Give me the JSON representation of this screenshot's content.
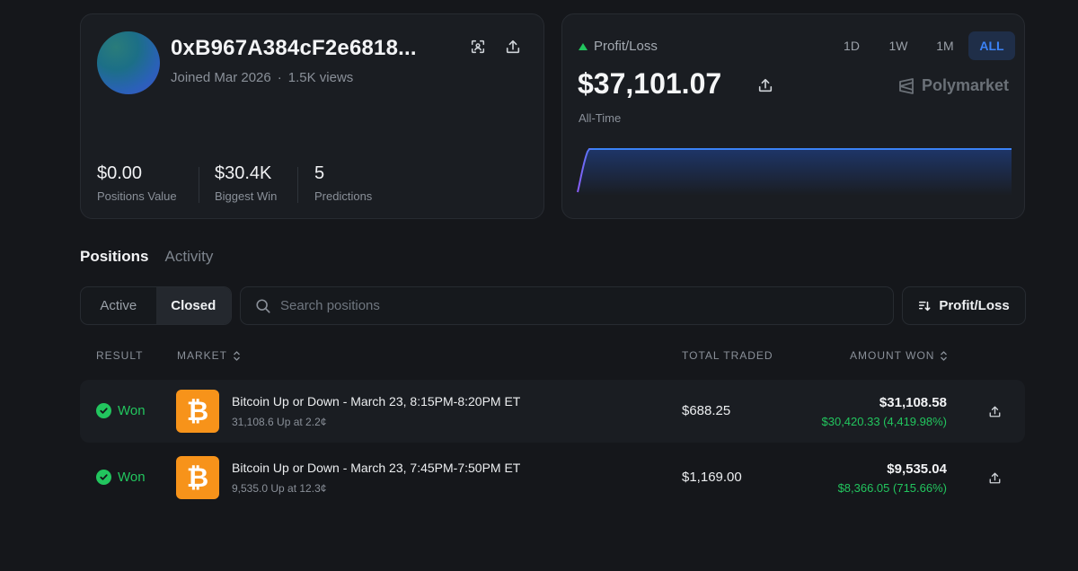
{
  "profile": {
    "wallet": "0xB967A384cF2e6818...",
    "joined": "Joined Mar 2026",
    "views": "1.5K views",
    "stats": [
      {
        "value": "$0.00",
        "label": "Positions Value"
      },
      {
        "value": "$30.4K",
        "label": "Biggest Win"
      },
      {
        "value": "5",
        "label": "Predictions"
      }
    ]
  },
  "pnl": {
    "label": "Profit/Loss",
    "value": "$37,101.07",
    "period": "All-Time",
    "brand": "Polymarket",
    "ranges": [
      "1D",
      "1W",
      "1M",
      "ALL"
    ],
    "active_range": "ALL",
    "chart": {
      "trend": "sharp rise then flat",
      "line_color": "#3b82f6"
    }
  },
  "tabs": {
    "positions": "Positions",
    "activity": "Activity"
  },
  "filter": {
    "active": "Active",
    "closed": "Closed",
    "selected": "Closed"
  },
  "search": {
    "placeholder": "Search positions"
  },
  "sort": {
    "label": "Profit/Loss"
  },
  "table": {
    "headers": {
      "result": "RESULT",
      "market": "MARKET",
      "total": "TOTAL TRADED",
      "amount": "AMOUNT WON"
    },
    "rows": [
      {
        "result": "Won",
        "market": "Bitcoin Up or Down - March 23, 8:15PM-8:20PM ET",
        "detail": "31,108.6 Up at 2.2¢",
        "total": "$688.25",
        "amount": "$31,108.58",
        "profit": "$30,420.33 (4,419.98%)"
      },
      {
        "result": "Won",
        "market": "Bitcoin Up or Down - March 23, 7:45PM-7:50PM ET",
        "detail": "9,535.0 Up at 12.3¢",
        "total": "$1,169.00",
        "amount": "$9,535.04",
        "profit": "$8,366.05 (715.66%)"
      }
    ]
  },
  "colors": {
    "accent": "#3b82f6",
    "positive": "#22c55e",
    "bitcoin": "#f7931a",
    "background": "#15171b",
    "card": "#1a1d22"
  },
  "icons": {
    "scan": "scan-icon",
    "share": "share-icon",
    "search": "search-icon",
    "sort": "sort-icon",
    "check": "check-icon",
    "bitcoin": "bitcoin-icon",
    "brand": "polymarket-logo-icon"
  }
}
